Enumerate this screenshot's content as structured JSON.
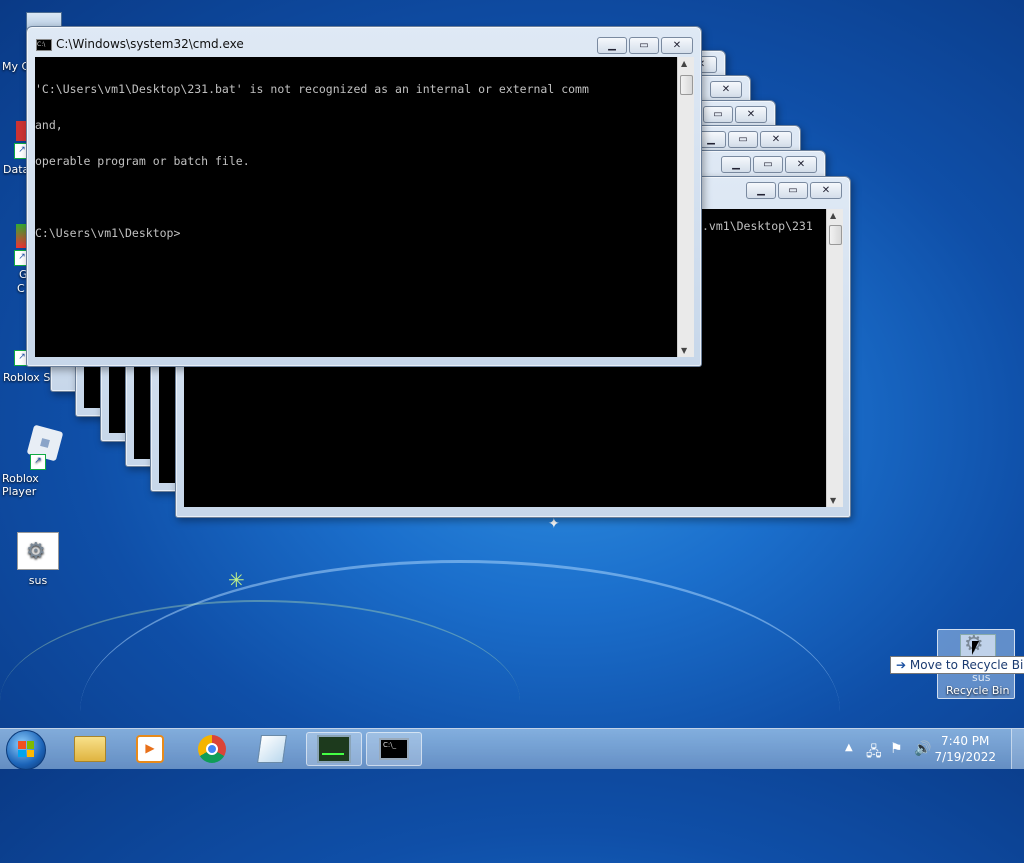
{
  "desktop": {
    "partial_icons": [
      {
        "label": "My C"
      },
      {
        "label": "Data"
      },
      {
        "label": "G"
      },
      {
        "label": "C"
      },
      {
        "label": "Roblox St"
      }
    ],
    "icons": [
      {
        "label": "Roblox Player"
      },
      {
        "label": "sus"
      }
    ],
    "recycle_bin": {
      "label": "Recycle Bin",
      "drag_label": "sus"
    },
    "tooltip": "Move to Recycle Bin"
  },
  "front_window": {
    "title": "C:\\Windows\\system32\\cmd.exe",
    "lines": [
      "'C:\\Users\\vm1\\Desktop\\231.bat' is not recognized as an internal or external comm",
      "and,",
      "operable program or batch file.",
      "",
      "C:\\Users\\vm1\\Desktop>"
    ]
  },
  "back_window": {
    "visible_text": ".vm1\\Desktop\\231"
  },
  "taskbar": {
    "clock_time": "7:40 PM",
    "clock_date": "7/19/2022"
  },
  "colors": {
    "console_bg": "#000000",
    "console_text": "#c0c0c0",
    "desktop_blue": "#1b6fcc"
  }
}
